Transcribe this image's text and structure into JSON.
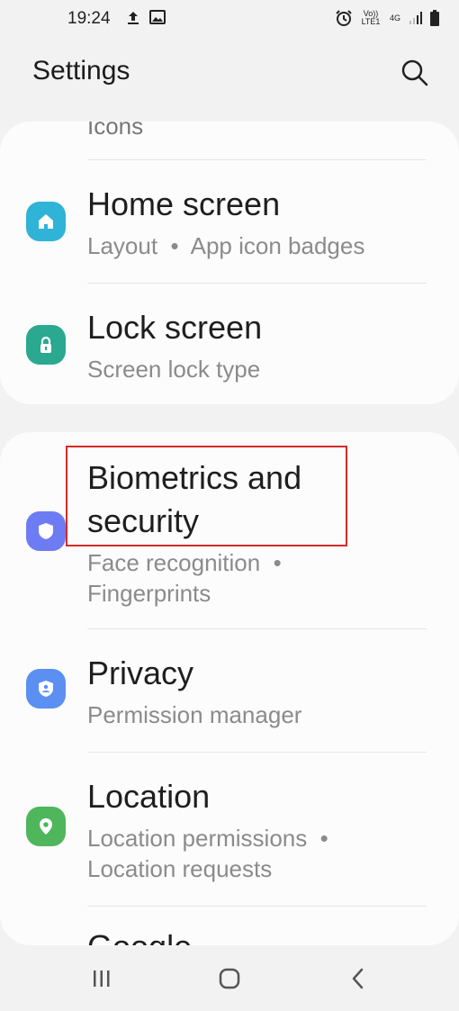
{
  "status": {
    "time": "19:24",
    "net_volte": "Vo)) LTE1",
    "net_gen": "4G"
  },
  "header": {
    "title": "Settings"
  },
  "items": [
    {
      "title": "Icons"
    },
    {
      "title": "Home screen",
      "subtitle": "Layout  •  App icon badges",
      "icon": "home-icon",
      "color": "#2fb3d6"
    },
    {
      "title": "Lock screen",
      "subtitle": "Screen lock type",
      "icon": "lock-icon",
      "color": "#2aa890"
    },
    {
      "title_line1": "Biometrics and",
      "title_line2": "security",
      "subtitle_line1": "Face recognition  •",
      "subtitle_line2": "Fingerprints",
      "icon": "shield-icon",
      "color": "#6e7cf3"
    },
    {
      "title": "Privacy",
      "subtitle": "Permission manager",
      "icon": "privacy-shield-icon",
      "color": "#5b8ff2"
    },
    {
      "title": "Location",
      "subtitle_line1": "Location permissions  •",
      "subtitle_line2": "Location requests",
      "icon": "location-pin-icon",
      "color": "#4fb65c"
    },
    {
      "title": "Google"
    }
  ],
  "nav": {
    "recents": "recents-icon",
    "home": "home-nav-icon",
    "back": "back-icon"
  }
}
